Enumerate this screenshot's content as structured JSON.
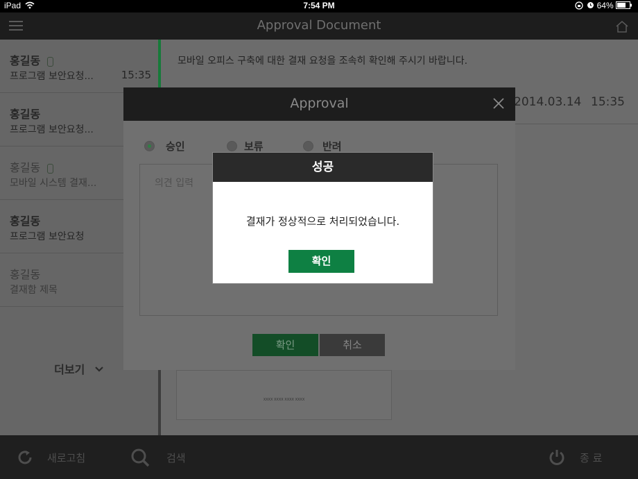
{
  "status_bar": {
    "device": "iPad",
    "time": "7:54 PM",
    "battery": "64%"
  },
  "header": {
    "title": "Approval Document",
    "menu_icon": "menu-icon",
    "home_icon": "home-icon"
  },
  "sidebar": {
    "items": [
      {
        "name": "홍길동",
        "subject": "프로그램 보안요청...",
        "time": "15:35",
        "attachment": true
      },
      {
        "name": "홍길동",
        "subject": "프로그램 보안요청...",
        "time": "",
        "attachment": false
      },
      {
        "name": "홍길동",
        "subject": "모바일 시스템 결재...",
        "time": "",
        "attachment": true
      },
      {
        "name": "홍길동",
        "subject": "프로그램 보안요청",
        "time": "",
        "attachment": false
      },
      {
        "name": "홍길동",
        "subject": "결재함 제목",
        "time": "",
        "attachment": false
      }
    ],
    "more_label": "더보기"
  },
  "content": {
    "message": "모바일 오피스 구축에 대한 결재 요청을 조속히 확인해 주시기 바랍니다.",
    "date": "2014.03.14",
    "time": "15:35",
    "preview_text": "XXXX  XXXX  XXXX  XXXX"
  },
  "approval_modal": {
    "title": "Approval",
    "options": [
      {
        "label": "승인",
        "selected": true
      },
      {
        "label": "보류",
        "selected": false
      },
      {
        "label": "반려",
        "selected": false
      }
    ],
    "comment_placeholder": "의견 입력",
    "confirm_label": "확인",
    "cancel_label": "취소"
  },
  "success_alert": {
    "title": "성공",
    "message": "결재가 정상적으로 처리되었습니다.",
    "confirm_label": "확인"
  },
  "toolbar": {
    "refresh_label": "새로고침",
    "search_label": "검색",
    "exit_label": "종 료"
  },
  "colors": {
    "accent_green": "#0e8043",
    "header_dark": "#1d1d1d"
  }
}
